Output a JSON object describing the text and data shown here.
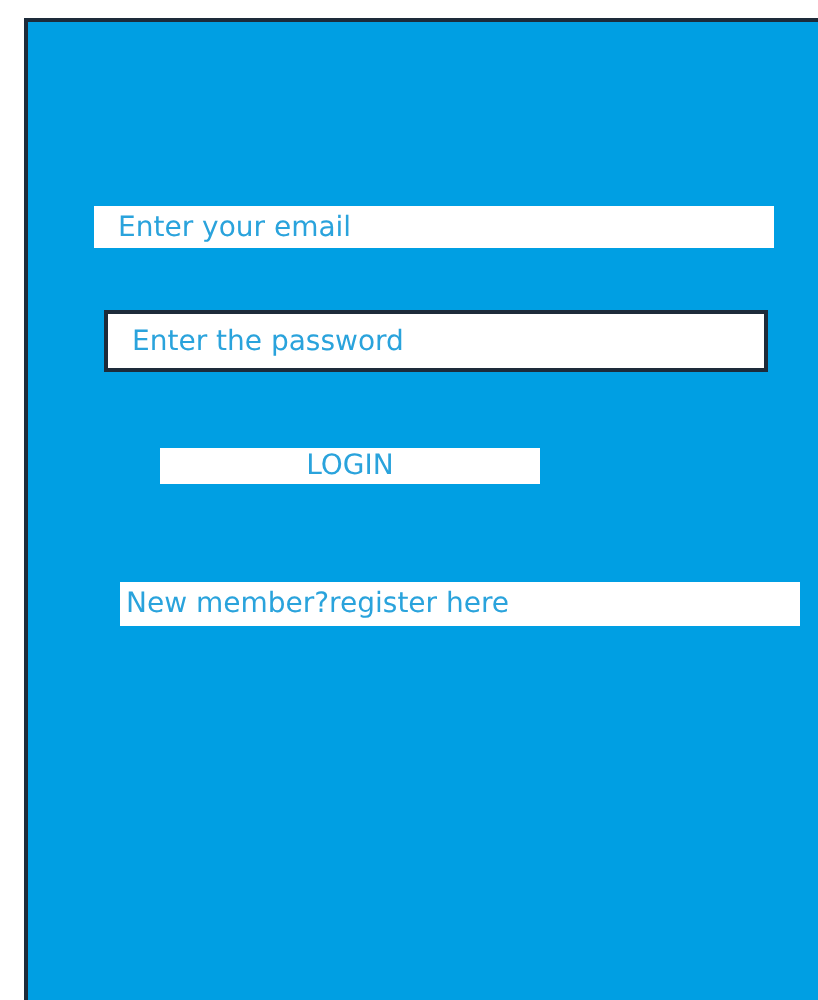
{
  "fields": [
    {
      "kind": "email",
      "placeholder": "Enter your email",
      "focused": false
    },
    {
      "kind": "password",
      "placeholder": "Enter the password",
      "focused": true
    }
  ],
  "login_button": {
    "label": "LOGIN"
  },
  "register_link": {
    "label": "New member?register here"
  }
}
